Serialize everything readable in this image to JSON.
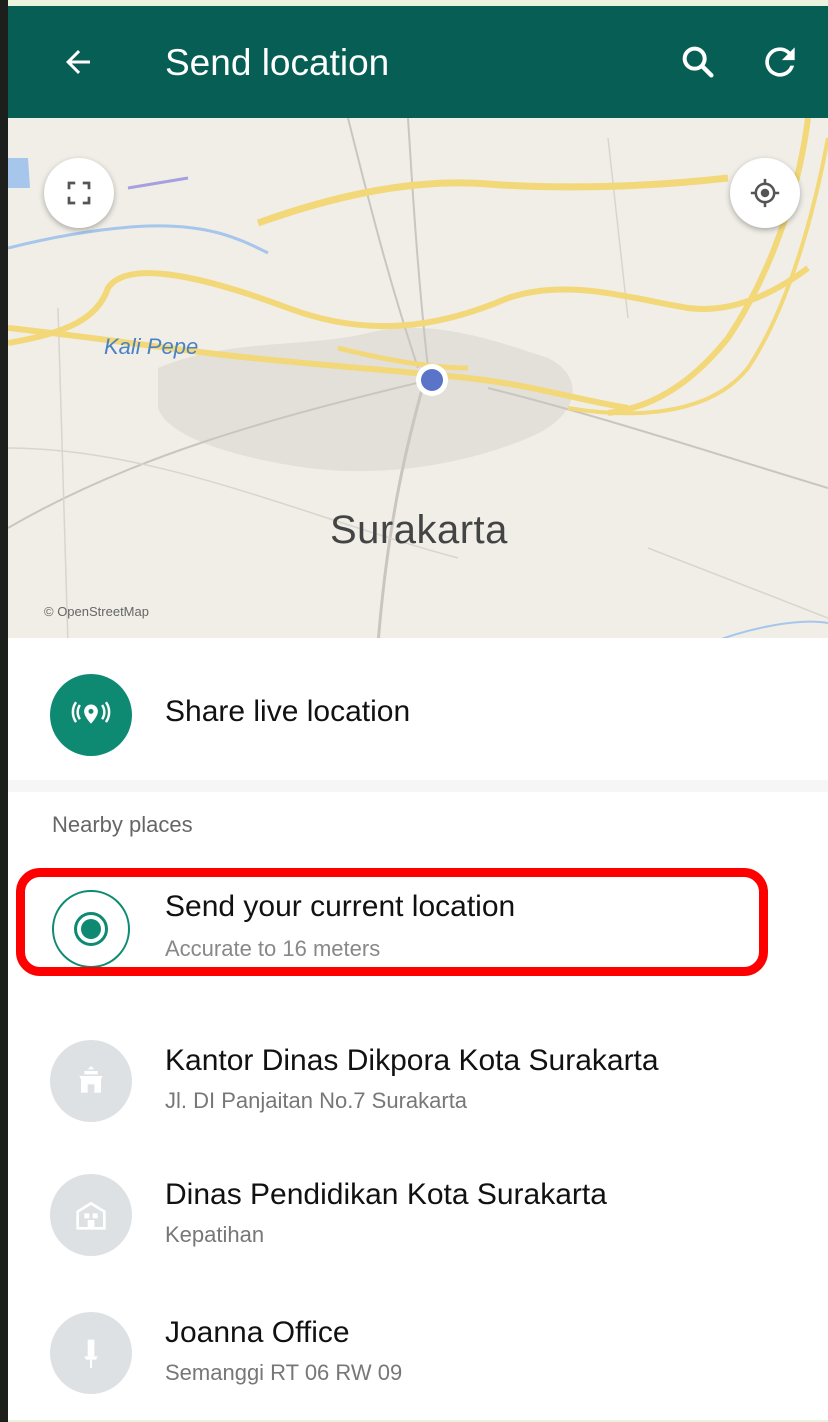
{
  "header": {
    "title": "Send location",
    "back_icon": "arrow-left-icon",
    "search_icon": "search-icon",
    "refresh_icon": "refresh-icon",
    "color": "#075e54"
  },
  "map": {
    "place_label": "Surakarta",
    "river_label": "Kali Pepe",
    "credit": "© OpenStreetMap",
    "fullscreen_icon": "fullscreen-icon",
    "my_location_icon": "my-location-icon"
  },
  "share_live": {
    "label": "Share live location",
    "icon": "live-location-icon",
    "accent": "#0e8a73"
  },
  "nearby": {
    "section_label": "Nearby places",
    "current": {
      "name": "Send your current location",
      "accuracy": "Accurate to 16 meters"
    },
    "places": [
      {
        "name": "Kantor Dinas Dikpora Kota Surakarta",
        "address": "Jl. DI Panjaitan No.7 Surakarta",
        "icon": "building-icon"
      },
      {
        "name": "Dinas Pendidikan Kota Surakarta",
        "address": "Kepatihan",
        "icon": "office-icon"
      },
      {
        "name": "Joanna Office",
        "address": "Semanggi RT 06 RW 09",
        "icon": "pin-icon"
      }
    ]
  }
}
